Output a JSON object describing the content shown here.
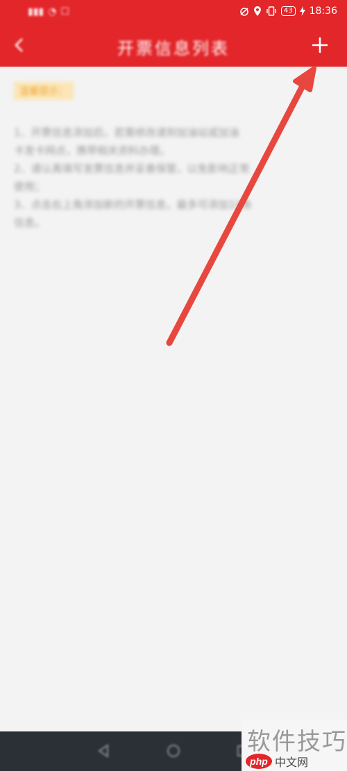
{
  "status_bar": {
    "left_icons": [
      "signal-icon",
      "wifi-icon",
      "message-icon"
    ],
    "right_icons": [
      "alarm-icon",
      "location-icon",
      "vibrate-icon",
      "battery-icon",
      "charging-icon"
    ],
    "battery_level": "43",
    "time": "18:36"
  },
  "app_bar": {
    "title": "开票信息列表",
    "back_icon": "back-arrow-icon",
    "add_icon": "plus-icon"
  },
  "content": {
    "tip_label": "温馨提示：",
    "lines": [
      "1、开票信息添加后，若需修改请到加油站或加油",
      "卡发卡网点，携带相关资料办理。",
      "2、请认真填写发票信息并妥善保管，以免影响正常",
      "使用；",
      "3、点击右上角添加新的开票信息，最多可添加10条",
      "信息。"
    ]
  },
  "annotation": {
    "color": "#e8473f",
    "points_to": "add-button"
  },
  "nav_bar": {
    "buttons": [
      "nav-back-icon",
      "nav-home-icon",
      "nav-recents-icon"
    ]
  },
  "watermark": {
    "title": "软件技巧",
    "logo": "php",
    "site": "中文网"
  },
  "colors": {
    "primary": "#e3262a",
    "background": "#f3f3f3",
    "nav": "#2b2f36"
  }
}
